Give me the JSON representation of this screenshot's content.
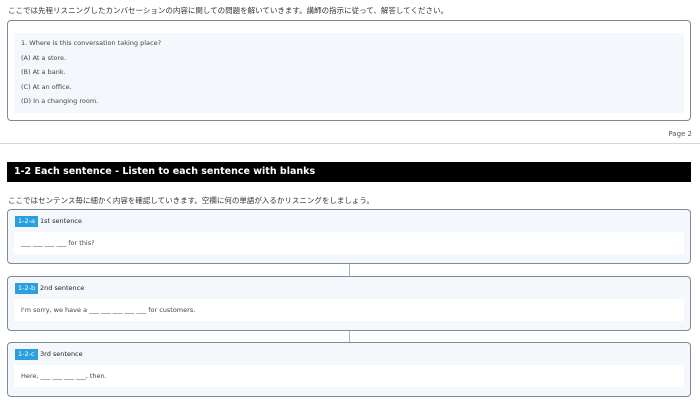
{
  "intro_top": "ここでは先程リスニングしたカンバセーションの内容に関しての問題を解いていきます。講師の指示に従って、解答してください。",
  "question": {
    "text": "1. Where is this conversation taking place?",
    "options": [
      "(A) At a store.",
      "(B) At a bank.",
      "(C) At an office.",
      "(D) In a changing room."
    ]
  },
  "page_label": "Page 2",
  "section": {
    "title": "1-2 Each sentence - Listen to each sentence with blanks",
    "intro": "ここではセンテンス毎に細かく内容を確認していきます。空欄に何の単語が入るかリスニングをしましょう。"
  },
  "sentences": [
    {
      "tag": "1-2-a",
      "title": "1st sentence",
      "text": "___ ___ ___ ___ for this?"
    },
    {
      "tag": "1-2-b",
      "title": "2nd sentence",
      "text": "I'm sorry, we have a ___ ___ ___ ___ ___ for customers."
    },
    {
      "tag": "1-2-c",
      "title": "3rd sentence",
      "text": "Here, ___ ___ ___ ___, then."
    }
  ]
}
